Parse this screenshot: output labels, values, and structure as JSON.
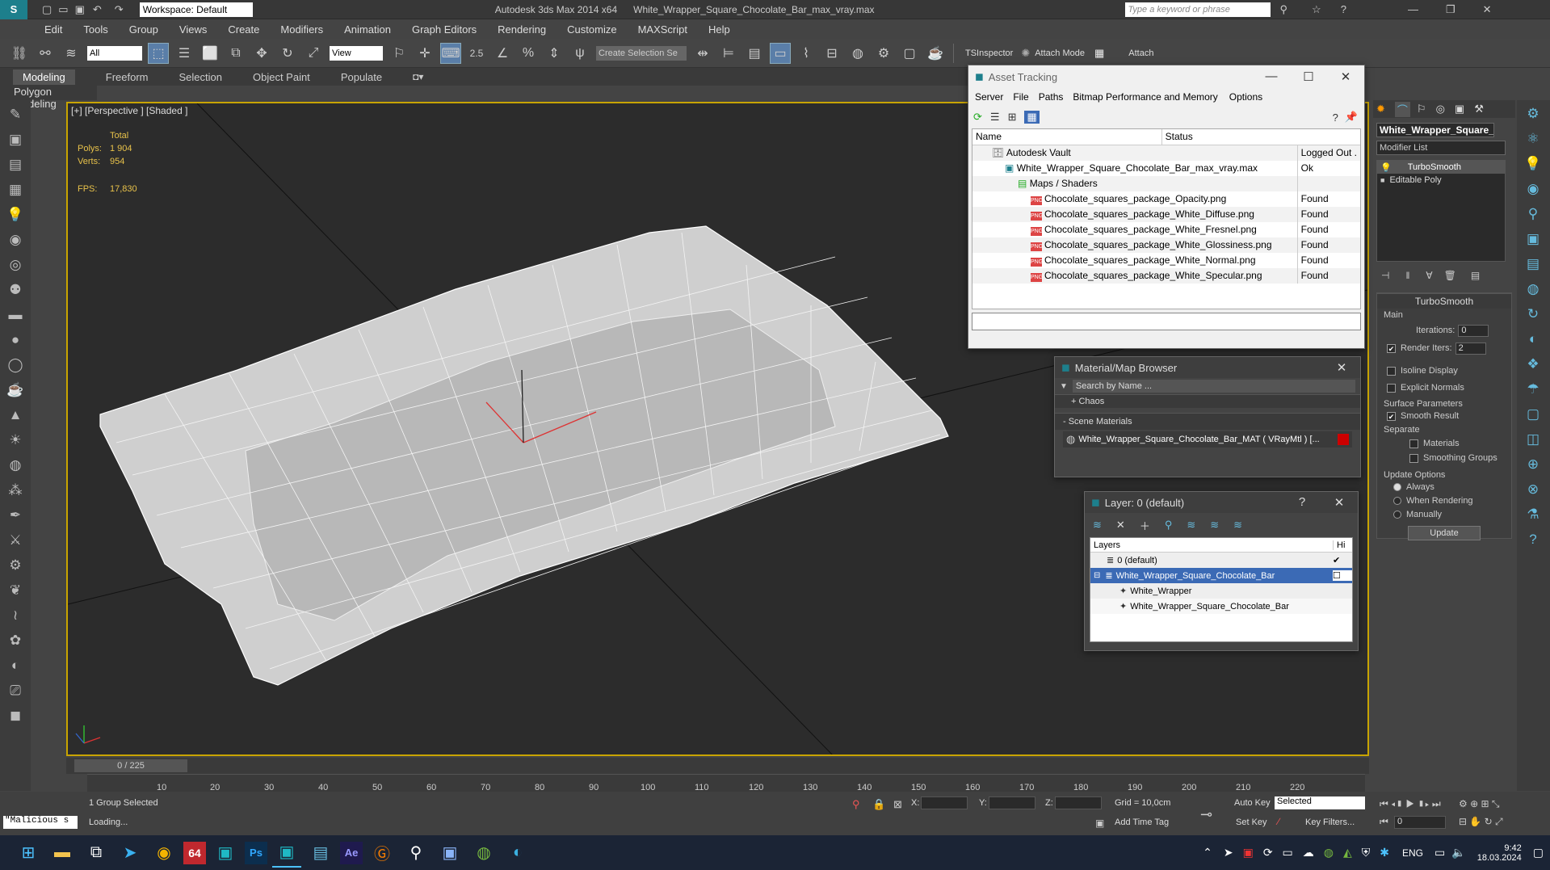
{
  "titlebar": {
    "workspace": "Workspace: Default",
    "app_title": "Autodesk 3ds Max  2014 x64",
    "file_title": "White_Wrapper_Square_Chocolate_Bar_max_vray.max",
    "search_placeholder": "Type a keyword or phrase"
  },
  "menu": [
    "Edit",
    "Tools",
    "Group",
    "Views",
    "Create",
    "Modifiers",
    "Animation",
    "Graph Editors",
    "Rendering",
    "Customize",
    "MAXScript",
    "Help"
  ],
  "toolbar": {
    "filter_value": "All",
    "view_value": "View",
    "snap_value": "2.5",
    "selection_set_placeholder": "Create Selection Se",
    "tsinspector": "TSInspector",
    "attach_mode": "Attach Mode",
    "attach": "Attach"
  },
  "ribbon": {
    "tabs": [
      "Modeling",
      "Freeform",
      "Selection",
      "Object Paint",
      "Populate"
    ],
    "sub": "Polygon Modeling"
  },
  "viewport": {
    "label": "[+] [Perspective ] [Shaded ]",
    "total_label": "Total",
    "polys_label": "Polys:",
    "polys": "1 904",
    "verts_label": "Verts:",
    "verts": "954",
    "fps_label": "FPS:",
    "fps": "17,830"
  },
  "asset_tracking": {
    "title": "Asset Tracking",
    "menu": [
      "Server",
      "File",
      "Paths",
      "Bitmap Performance and Memory",
      "Options"
    ],
    "col_name": "Name",
    "col_status": "Status",
    "rows": [
      {
        "name": "Autodesk Vault",
        "status": "Logged Out ."
      },
      {
        "name": "White_Wrapper_Square_Chocolate_Bar_max_vray.max",
        "status": "Ok"
      },
      {
        "name": "Maps / Shaders",
        "status": ""
      },
      {
        "name": "Chocolate_squares_package_Opacity.png",
        "status": "Found"
      },
      {
        "name": "Chocolate_squares_package_White_Diffuse.png",
        "status": "Found"
      },
      {
        "name": "Chocolate_squares_package_White_Fresnel.png",
        "status": "Found"
      },
      {
        "name": "Chocolate_squares_package_White_Glossiness.png",
        "status": "Found"
      },
      {
        "name": "Chocolate_squares_package_White_Normal.png",
        "status": "Found"
      },
      {
        "name": "Chocolate_squares_package_White_Specular.png",
        "status": "Found"
      }
    ]
  },
  "material_browser": {
    "title": "Material/Map Browser",
    "search_placeholder": "Search by Name ...",
    "chaos": "+ Chaos",
    "scene_materials": "- Scene Materials",
    "material": "White_Wrapper_Square_Chocolate_Bar_MAT  ( VRayMtl )  [..."
  },
  "layer_window": {
    "title": "Layer: 0 (default)",
    "col_layers": "Layers",
    "col_hi": "Hi",
    "rows": [
      "0 (default)",
      "White_Wrapper_Square_Chocolate_Bar",
      "White_Wrapper",
      "White_Wrapper_Square_Chocolate_Bar"
    ]
  },
  "command_panel": {
    "object_name": "White_Wrapper_Square_",
    "modifier_list": "Modifier List",
    "stack": [
      "TurboSmooth",
      "Editable Poly"
    ],
    "rollout": "TurboSmooth",
    "main": "Main",
    "iterations_label": "Iterations:",
    "iterations": "0",
    "render_iters_label": "Render Iters:",
    "render_iters": "2",
    "isoline": "Isoline Display",
    "explicit": "Explicit Normals",
    "surface": "Surface Parameters",
    "smooth_result": "Smooth Result",
    "separate": "Separate",
    "materials": "Materials",
    "smoothing_groups": "Smoothing Groups",
    "update_options": "Update Options",
    "always": "Always",
    "when_rendering": "When Rendering",
    "manually": "Manually",
    "update": "Update"
  },
  "timeline": {
    "frame": "0 / 225",
    "ticks": [
      "10",
      "20",
      "30",
      "40",
      "50",
      "60",
      "70",
      "80",
      "90",
      "100",
      "110",
      "120",
      "130",
      "140",
      "150",
      "160",
      "170",
      "180",
      "190",
      "200",
      "210",
      "220"
    ]
  },
  "status": {
    "script": "\"Malicious s",
    "selected": "1 Group Selected",
    "loading": "Loading...",
    "x": "X:",
    "y": "Y:",
    "z": "Z:",
    "grid": "Grid = 10,0cm",
    "add_time_tag": "Add Time Tag",
    "auto_key": "Auto Key",
    "set_key": "Set Key",
    "selected_dd": "Selected",
    "key_filters": "Key Filters...",
    "frame_val": "0"
  },
  "taskbar": {
    "lang": "ENG",
    "time": "9:42",
    "date": "18.03.2024",
    "badge": "64",
    "ae": "Ae",
    "ps": "Ps"
  }
}
